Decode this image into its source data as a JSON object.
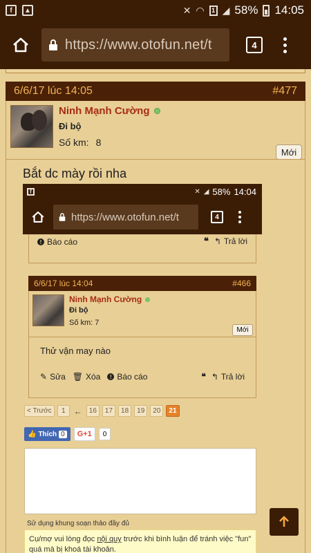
{
  "status_bar": {
    "battery": "58%",
    "time": "14:05",
    "sim": "1"
  },
  "browser": {
    "url": "https://www.otofun.net/t",
    "tab_count": "4"
  },
  "post": {
    "date": "6/6/17 lúc 14:05",
    "number": "#477",
    "username": "Ninh Mạnh Cường",
    "rank": "Đi bộ",
    "km_label": "Số km:",
    "km_value": "8",
    "new_badge": "Mới",
    "message": "Bắt dc mày rồi nha"
  },
  "screenshot": {
    "status_battery": "58%",
    "status_time": "14:04",
    "url": "https://www.otofun.net/t",
    "tab_count": "4",
    "prev_report": "Báo cáo",
    "prev_quote": "❝",
    "prev_reply": "Trả lời",
    "post_date": "6/6/17 lúc 14:04",
    "post_number": "#466",
    "username": "Ninh Mạnh Cường",
    "rank": "Đi bộ",
    "km": "Số km: 7",
    "new_badge": "Mới",
    "message": "Thử vận may nào",
    "edit": "Sửa",
    "delete": "Xóa",
    "report": "Báo cáo",
    "reply": "Trả lời",
    "pager": {
      "prev": "< Trước",
      "first": "1",
      "arrow": "←",
      "pages": [
        "16",
        "17",
        "18",
        "19",
        "20",
        "21"
      ],
      "current": "21"
    },
    "like_label": "Thích",
    "like_count": "0",
    "gplus_label": "G+1",
    "gplus_count": "0",
    "full_editor": "Sử dụng khung soạn thảo đầy đủ",
    "notice_before": "Cụ/mợ vui lòng đọc ",
    "notice_link": "nội quy",
    "notice_after": " trước khi bình luận để tránh việc \"fun\" quá mà bị khoá tài khoản."
  }
}
